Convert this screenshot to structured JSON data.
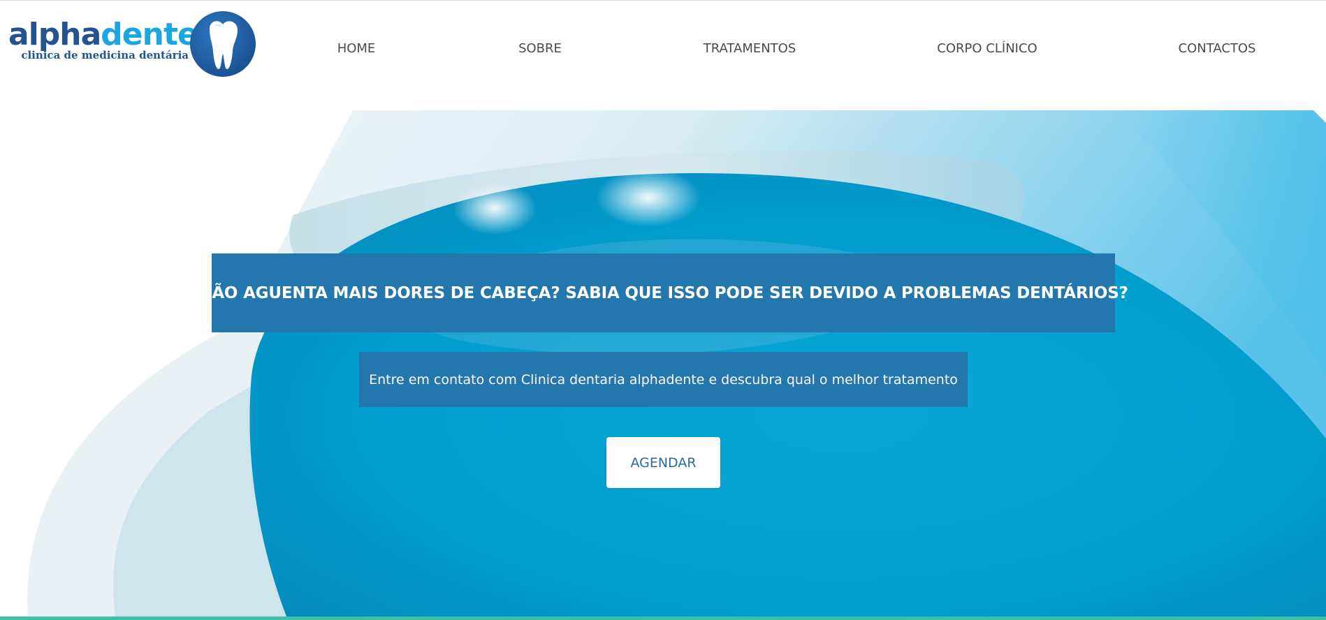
{
  "brand": {
    "name_part1": "alpha",
    "name_part2": "dente",
    "tagline": "clinica de medicina dentária",
    "logo_icon": "tooth-icon",
    "colors": {
      "dark_blue": "#24538f",
      "light_blue": "#1aa6e0"
    }
  },
  "nav": {
    "items": [
      {
        "label": "HOME"
      },
      {
        "label": "SOBRE"
      },
      {
        "label": "TRATAMENTOS"
      },
      {
        "label": "CORPO CLÍNICO"
      },
      {
        "label": "CONTACTOS"
      }
    ]
  },
  "hero": {
    "headline": "NÃO AGUENTA MAIS DORES DE CABEÇA? SABIA QUE ISSO PODE SER DEVIDO A PROBLEMAS DENTÁRIOS?",
    "subheadline": "Entre em contato com Clinica dentaria alphadente e descubra qual o melhor tratamento",
    "cta_label": "AGENDAR",
    "colors": {
      "box": "#2377ad",
      "cta_text": "#2a6aa1",
      "accent_bar": "#3fbfa8"
    }
  }
}
